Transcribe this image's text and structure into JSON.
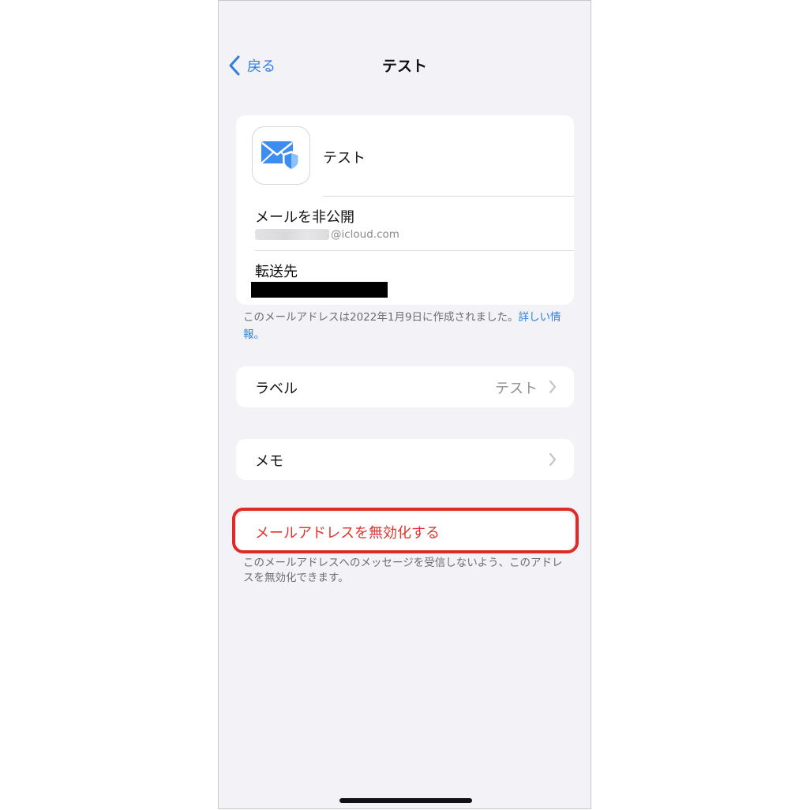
{
  "nav": {
    "back_label": "戻る",
    "title": "テスト"
  },
  "summary": {
    "app_name": "テスト",
    "hide_email_label": "メールを非公開",
    "email_domain": "@icloud.com",
    "forward_label": "転送先",
    "icon": "mail-shield-icon"
  },
  "created_note": {
    "text": "このメールアドレスは2022年1月9日に作成されました。",
    "link_part1": "詳しい情",
    "link_part2": "報。"
  },
  "label_row": {
    "label": "ラベル",
    "value": "テスト"
  },
  "memo_row": {
    "label": "メモ"
  },
  "deactivate": {
    "label": "メールアドレスを無効化する",
    "note_line1": "このメールアドレスへのメッセージを受信しないよう、このアドレ",
    "note_line2": "スを無効化できます。"
  },
  "colors": {
    "accent": "#2f7fe0",
    "destructive": "#e0332e",
    "highlight": "#df2a2a",
    "background": "#f2f2f7"
  }
}
